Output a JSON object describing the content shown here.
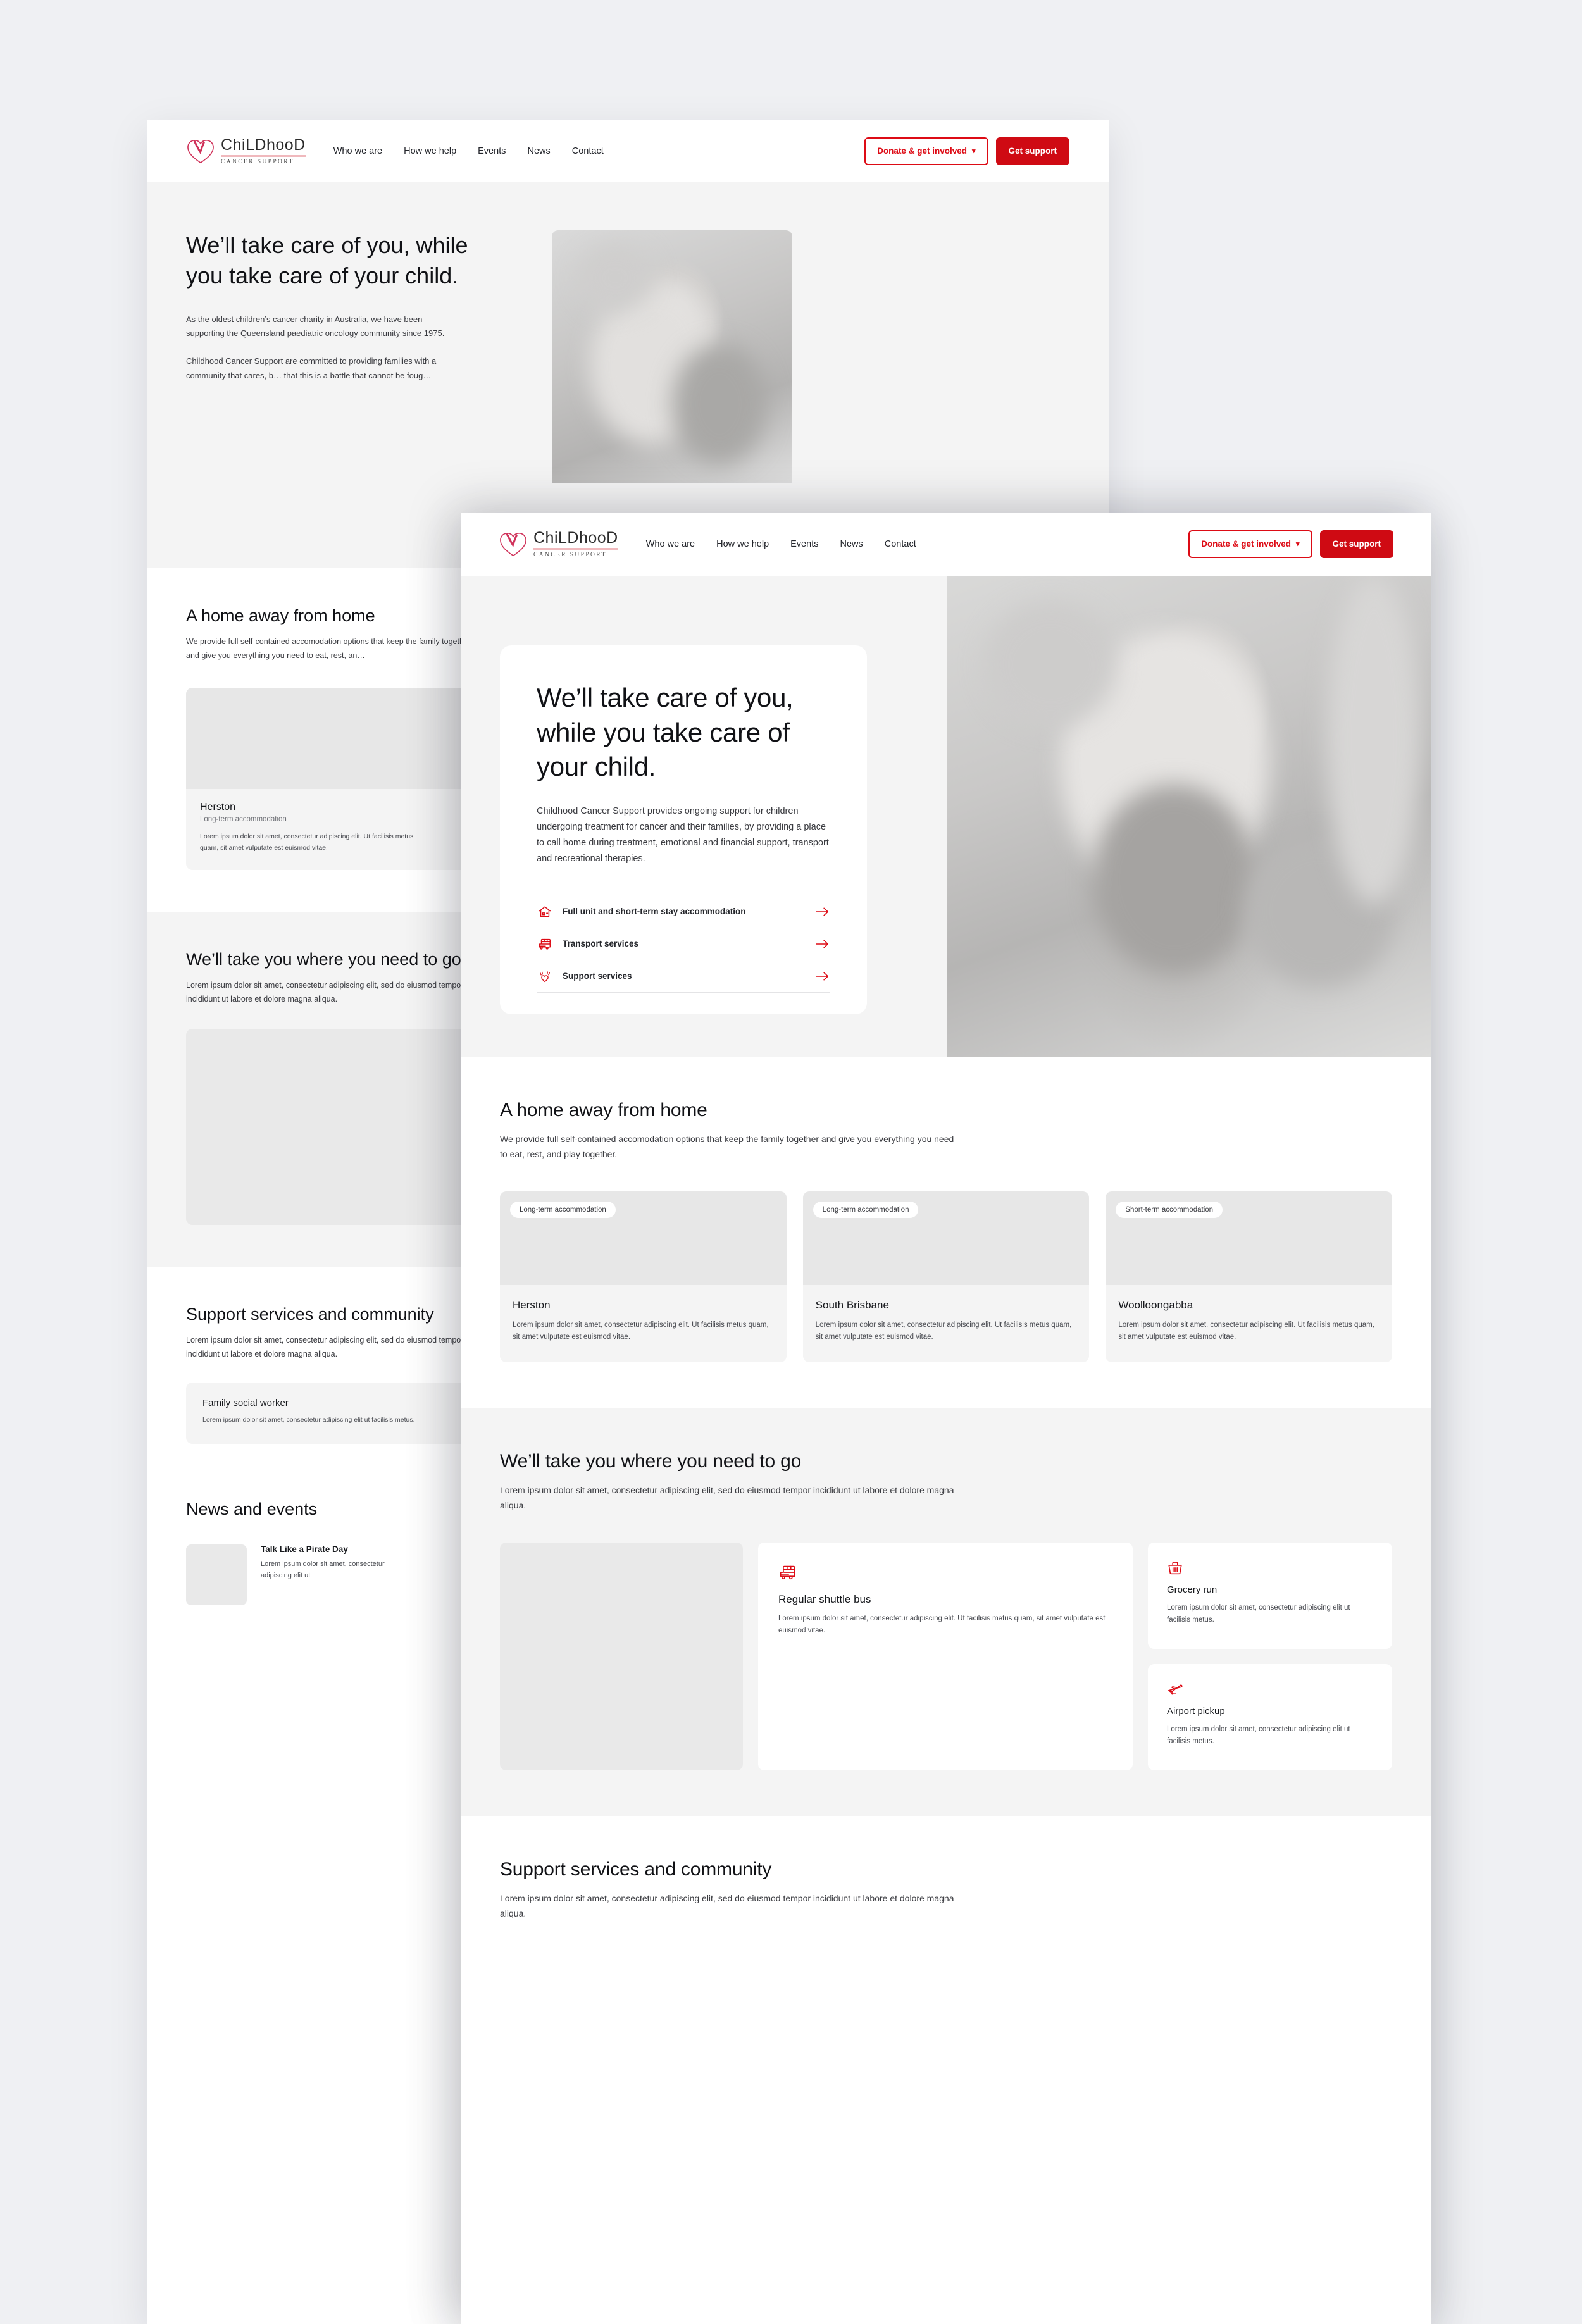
{
  "brand": {
    "name": "ChiLDhooD",
    "tagline": "CANCER SUPPORT",
    "heart_icon": "heart-ribbon-icon"
  },
  "nav": {
    "links": [
      {
        "label": "Who we are"
      },
      {
        "label": "How we help"
      },
      {
        "label": "Events"
      },
      {
        "label": "News"
      },
      {
        "label": "Contact"
      }
    ],
    "donate_button": "Donate & get involved",
    "donate_chevron": "chevron-down-icon",
    "support_button": "Get support"
  },
  "colors": {
    "brand_red": "#dd0b15",
    "solid_red": "#cf0a13",
    "page_bg": "#eff0f3",
    "section_grey": "#f4f4f4"
  },
  "front_page": {
    "hero": {
      "heading": "We’ll take care of you, while you take care of your child.",
      "body": "Childhood Cancer Support provides ongoing support for children undergoing treatment for cancer and their families, by providing a place to call home during treatment, emotional and financial support, transport and recreational therapies.",
      "photo_alt": "smiling-child-in-headscarf-photo",
      "links": [
        {
          "label": "Full unit and short-term stay accommodation",
          "icon": "house-icon",
          "arrow": "arrow-right-icon"
        },
        {
          "label": "Transport services",
          "icon": "bus-icon",
          "arrow": "arrow-right-icon"
        },
        {
          "label": "Support services",
          "icon": "heart-hands-icon",
          "arrow": "arrow-right-icon"
        }
      ]
    },
    "accommodation": {
      "heading": "A home away from home",
      "lead": "We provide full self-contained accomodation options that keep the family together and give you everything you need to eat, rest, and play together.",
      "cards": [
        {
          "badge": "Long-term accommodation",
          "title": "Herston",
          "text": "Lorem ipsum dolor sit amet, consectetur adipiscing elit. Ut facilisis metus quam, sit amet vulputate est euismod vitae."
        },
        {
          "badge": "Long-term accommodation",
          "title": "South Brisbane",
          "text": "Lorem ipsum dolor sit amet, consectetur adipiscing elit. Ut facilisis metus quam, sit amet vulputate est euismod vitae."
        },
        {
          "badge": "Short-term accommodation",
          "title": "Woolloongabba",
          "text": "Lorem ipsum dolor sit amet, consectetur adipiscing elit. Ut facilisis metus quam, sit amet vulputate est euismod vitae."
        }
      ]
    },
    "transport": {
      "heading": "We’ll take you where you need to go",
      "lead": "Lorem ipsum dolor sit amet, consectetur adipiscing elit, sed do eiusmod tempor incididunt ut labore et dolore magna aliqua.",
      "photo_alt": "transport-placeholder-image",
      "main_card": {
        "icon": "bus-icon",
        "title": "Regular shuttle bus",
        "text": "Lorem ipsum dolor sit amet, consectetur adipiscing elit. Ut facilisis metus quam, sit amet vulputate est euismod vitae."
      },
      "side_cards": [
        {
          "icon": "basket-icon",
          "title": "Grocery run",
          "text": "Lorem ipsum dolor sit amet, consectetur adipiscing elit ut facilisis metus."
        },
        {
          "icon": "plane-icon",
          "title": "Airport pickup",
          "text": "Lorem ipsum dolor sit amet, consectetur adipiscing elit ut facilisis metus."
        }
      ]
    },
    "support": {
      "heading": "Support services and community",
      "lead": "Lorem ipsum dolor sit amet, consectetur adipiscing elit, sed do eiusmod tempor incididunt ut labore et dolore magna aliqua."
    }
  },
  "back_page": {
    "hero": {
      "heading": "We’ll take care of you, while you take care of your child.",
      "paragraph_1": "As the oldest children’s cancer charity in Australia, we have been supporting the Queensland paediatric oncology community since 1975.",
      "paragraph_2": "Childhood Cancer Support are committed to providing families with a community that cares, b… that this is a battle that cannot be foug…",
      "photo_alt": "smiling-child-in-headscarf-photo"
    },
    "accommodation": {
      "heading": "A home away from home",
      "lead": "We provide full self-contained accomodation options that keep the family together and give you everything you need to eat, rest, an…",
      "card": {
        "title": "Herston",
        "subtitle": "Long-term accommodation",
        "text": "Lorem ipsum dolor sit amet, consectetur adipiscing elit. Ut facilisis metus quam, sit amet vulputate est euismod vitae."
      }
    },
    "transport": {
      "heading": "We’ll take you where you need to go",
      "lead": "Lorem ipsum dolor sit amet, consectetur adipiscing elit, sed do eiusmod tempor incididunt ut labore et dolore magna aliqua.",
      "photo_alt": "transport-placeholder-image"
    },
    "support": {
      "heading": "Support services and community",
      "lead": "Lorem ipsum dolor sit amet, consectetur adipiscing elit, sed do eiusmod tempor incididunt ut labore et dolore magna aliqua.",
      "card": {
        "title": "Family social worker",
        "text": "Lorem ipsum dolor sit amet, consectetur adipiscing elit ut facilisis metus."
      }
    },
    "news": {
      "heading": "News and events",
      "item": {
        "title": "Talk Like a Pirate Day",
        "text": "Lorem ipsum dolor sit amet, consectetur adipiscing elit ut"
      }
    }
  }
}
